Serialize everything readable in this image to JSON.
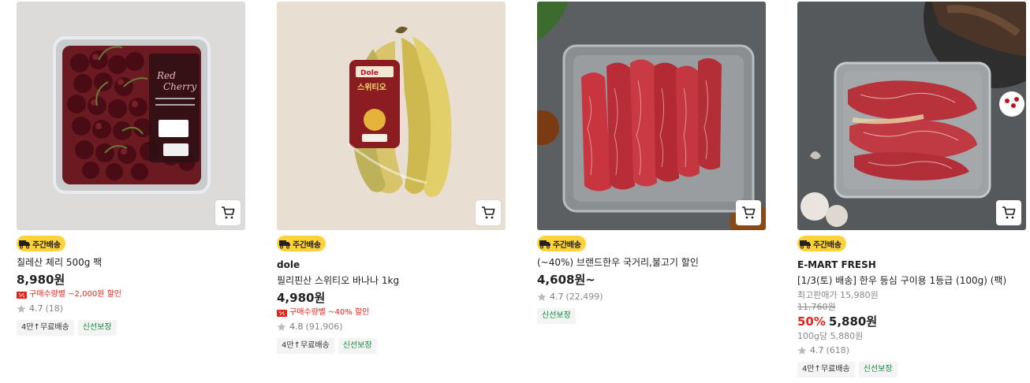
{
  "products": [
    {
      "badge": "주간배송",
      "brand": "",
      "name": "칠레산 체리 500g 팩",
      "price": "8,980원",
      "coupon": "구매수량별 ~2,000원 할인",
      "rating": "4.7",
      "reviews": "(18)",
      "tags": [
        "4만↑무료배송",
        "신선보장"
      ],
      "package_label": "Red Cherry"
    },
    {
      "badge": "주간배송",
      "brand": "dole",
      "name": "필리핀산 스위티오 바나나 1kg",
      "price": "4,980원",
      "coupon": "구매수량별 ~40% 할인",
      "rating": "4.8",
      "reviews": "(91,906)",
      "tags": [
        "4만↑무료배송",
        "신선보장"
      ],
      "package_label": "스위티오"
    },
    {
      "badge": "주간배송",
      "brand": "",
      "name": "(~40%) 브랜드한우 국거리,불고기 할인",
      "price": "4,608원~",
      "rating": "4.7",
      "reviews": "(22,499)",
      "tags": [
        "신선보장"
      ]
    },
    {
      "badge": "주간배송",
      "brand": "E-MART FRESH",
      "name": "[1/3(토) 배송] 한우 등심 구이용 1등급 (100g) (팩)",
      "best_price": "최고판매가 15,980원",
      "original_price": "11,760원",
      "discount": "50%",
      "price": "5,880원",
      "unit_price": "100g당 5,880원",
      "rating": "4.7",
      "reviews": "(618)",
      "tags": [
        "4만↑무료배송",
        "신선보장"
      ]
    }
  ],
  "colors": {
    "badge_yellow": "#ffd23a",
    "sale_red": "#e1251b",
    "fresh_green": "#0d8a3c"
  }
}
